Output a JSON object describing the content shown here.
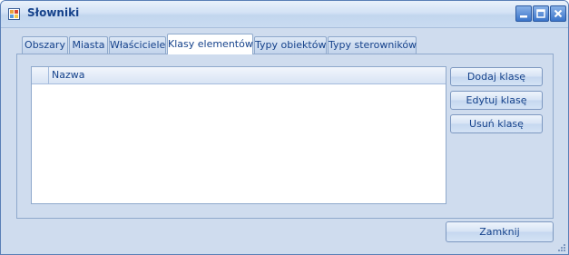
{
  "window": {
    "title": "Słowniki",
    "app_icon": "app-window-icon",
    "controls": [
      "minimize-icon",
      "maximize-icon",
      "close-icon"
    ]
  },
  "tabs": [
    {
      "label": "Obszary",
      "active": false
    },
    {
      "label": "Miasta",
      "active": false
    },
    {
      "label": "Właściciele",
      "active": false
    },
    {
      "label": "Klasy elementów",
      "active": true
    },
    {
      "label": "Typy obiektów",
      "active": false
    },
    {
      "label": "Typy sterowników",
      "active": false
    }
  ],
  "grid": {
    "columns": [
      "Nazwa"
    ],
    "rows": []
  },
  "actions": {
    "add": "Dodaj klasę",
    "edit": "Edytuj klasę",
    "remove": "Usuń klasę"
  },
  "footer": {
    "close": "Zamknij"
  },
  "colors": {
    "accent": "#15428b",
    "background": "#cfdcee",
    "border": "#8fa9cc"
  }
}
